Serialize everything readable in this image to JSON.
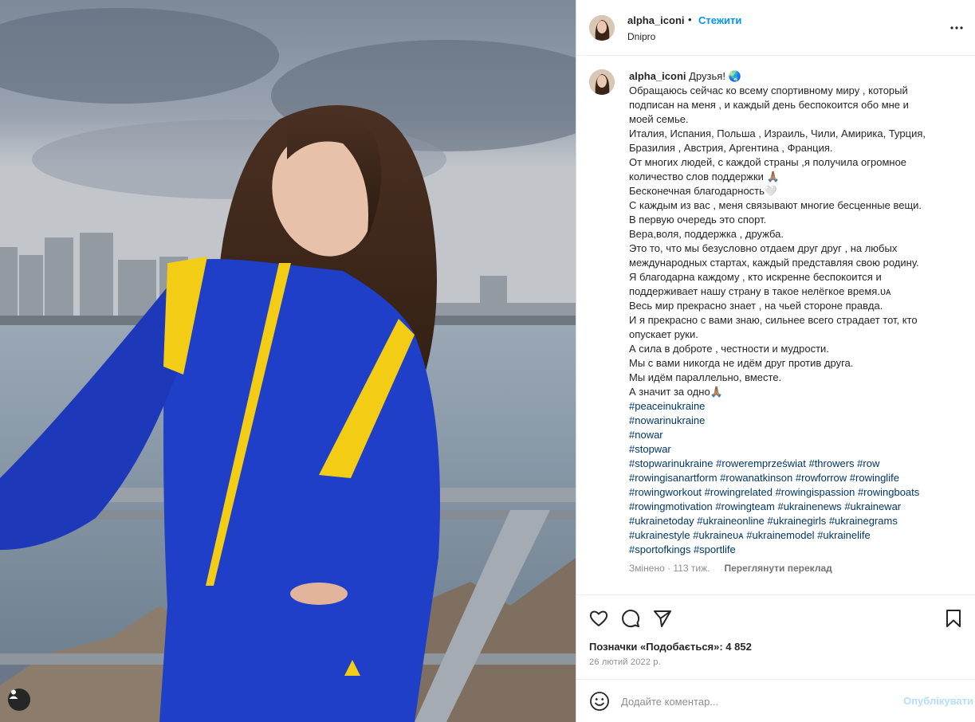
{
  "post": {
    "username": "alpha_iconi",
    "separator": "•",
    "follow_label": "Стежити",
    "location": "Dnipro"
  },
  "caption": {
    "username": "alpha_iconi",
    "lines": [
      "Друзья! 🌏",
      "Обращаюсь сейчас ко всему спортивному миру , который",
      "подписан на меня , и каждый день беспокоится обо мне и",
      "моей семье.",
      "Италия, Испания, Польша , Израиль, Чили, Амирика, Турция,",
      "Бразилия , Австрия, Аргентина , Франция.",
      "От многих людей, с каждой страны ,я получила огромное",
      "количество слов поддержки 🙏🏽",
      "Бесконечная благодарность🤍",
      "С каждым из вас , меня связывают многие бесценные вещи.",
      "В первую очередь это спорт.",
      "Вера,воля, поддержка , дружба.",
      "Это то, что мы безусловно отдаем друг друг , на любых",
      "международных стартах, каждый представляя свою родину.",
      "Я благодарна каждому , кто искренне беспокоится и",
      "поддерживает нашу страну в такое нелёгкое время.ᴜᴀ",
      "Весь мир прекрасно знает , на чьей стороне правда.",
      "И я прекрасно с вами знаю, сильнее всего страдает тот, кто",
      "опускает руки.",
      "А сила в доброте , честности и мудрости.",
      "Мы с вами никогда не идём друг против друга.",
      "Мы идём параллельно, вместе.",
      "А значит за одно🙏🏽"
    ],
    "hashtag_lines": [
      [
        "#peaceinukraine"
      ],
      [
        "#nowarinukraine"
      ],
      [
        "#nowar"
      ],
      [
        "#stopwar"
      ],
      [
        "#stopwarinukraine",
        "#roweremprzeświat",
        "#throwers",
        "#row"
      ],
      [
        "#rowingisanartform",
        "#rowanatkinson",
        "#rowforrow",
        "#rowinglife"
      ],
      [
        "#rowingworkout",
        "#rowingrelated",
        "#rowingispassion",
        "#rowingboats"
      ],
      [
        "#rowingmotivation",
        "#rowingteam",
        "#ukrainenews",
        "#ukrainewar"
      ],
      [
        "#ukrainetoday",
        "#ukraineonline",
        "#ukrainegirls",
        "#ukrainegrams"
      ],
      [
        "#ukrainestyle",
        "#ukraineᴜᴀ",
        "#ukrainemodel",
        "#ukrainelife"
      ],
      [
        "#sportofkings",
        "#sportlife"
      ]
    ],
    "edited_time": "Змінено · 113 тиж.",
    "translate_label": "Переглянути переклад"
  },
  "icons": {
    "tag": "user-tag-icon",
    "more": "more-options-icon",
    "like": "heart-icon",
    "comment": "comment-icon",
    "share": "share-icon",
    "save": "bookmark-icon",
    "emoji": "emoji-icon"
  },
  "stats": {
    "likes_text": "Позначки «Подобається»: 4 852",
    "date": "26 лютий 2022 р."
  },
  "comment_box": {
    "placeholder": "Додайте коментар...",
    "post_label": "Опублікувати"
  },
  "colors": {
    "accent": "#0095f6",
    "hashtag": "#00376b",
    "post_disabled": "#b2dffc",
    "jacket_blue": "#1f3fc8",
    "jacket_yellow": "#f2cc15"
  }
}
